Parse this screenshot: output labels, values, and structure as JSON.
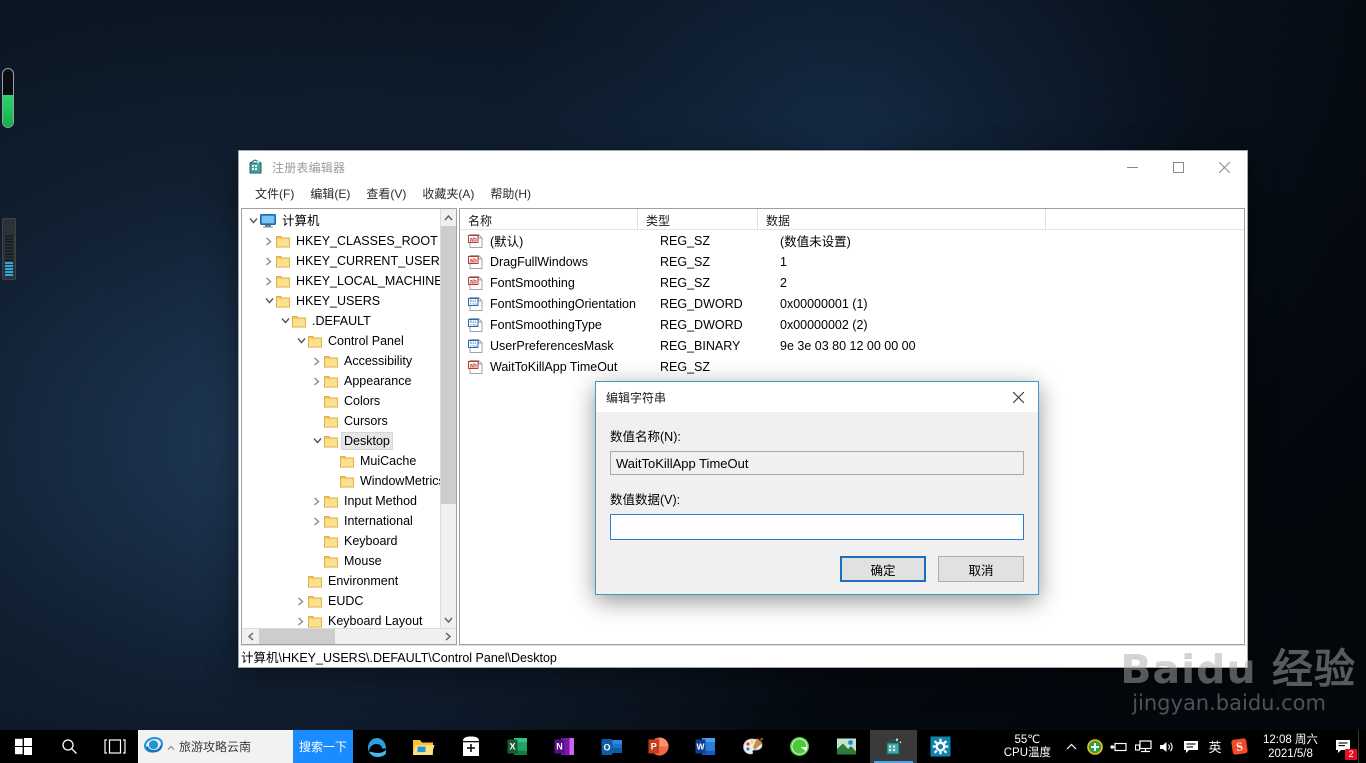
{
  "window": {
    "title": "注册表编辑器",
    "app_icon": "regedit-icon",
    "controls": {
      "minimize": "最小化",
      "maximize": "最大化",
      "close": "关闭"
    },
    "menu": [
      {
        "label": "文件(F)",
        "name": "menu-file"
      },
      {
        "label": "编辑(E)",
        "name": "menu-edit"
      },
      {
        "label": "查看(V)",
        "name": "menu-view"
      },
      {
        "label": "收藏夹(A)",
        "name": "menu-favorites"
      },
      {
        "label": "帮助(H)",
        "name": "menu-help"
      }
    ],
    "status_path": "计算机\\HKEY_USERS\\.DEFAULT\\Control Panel\\Desktop"
  },
  "tree": {
    "nodes": [
      {
        "label": "计算机",
        "indent": 0,
        "chevron": "down",
        "icon": "computer-icon",
        "selected": false
      },
      {
        "label": "HKEY_CLASSES_ROOT",
        "indent": 1,
        "chevron": "right",
        "icon": "folder-icon",
        "selected": false
      },
      {
        "label": "HKEY_CURRENT_USER",
        "indent": 1,
        "chevron": "right",
        "icon": "folder-icon",
        "selected": false
      },
      {
        "label": "HKEY_LOCAL_MACHINE",
        "indent": 1,
        "chevron": "right",
        "icon": "folder-icon",
        "selected": false
      },
      {
        "label": "HKEY_USERS",
        "indent": 1,
        "chevron": "down",
        "icon": "folder-icon",
        "selected": false
      },
      {
        "label": ".DEFAULT",
        "indent": 2,
        "chevron": "down",
        "icon": "folder-icon",
        "selected": false
      },
      {
        "label": "Control Panel",
        "indent": 3,
        "chevron": "down",
        "icon": "folder-icon",
        "selected": false
      },
      {
        "label": "Accessibility",
        "indent": 4,
        "chevron": "right",
        "icon": "folder-icon",
        "selected": false
      },
      {
        "label": "Appearance",
        "indent": 4,
        "chevron": "right",
        "icon": "folder-icon",
        "selected": false
      },
      {
        "label": "Colors",
        "indent": 4,
        "chevron": "none",
        "icon": "folder-icon",
        "selected": false
      },
      {
        "label": "Cursors",
        "indent": 4,
        "chevron": "none",
        "icon": "folder-icon",
        "selected": false
      },
      {
        "label": "Desktop",
        "indent": 4,
        "chevron": "down",
        "icon": "folder-icon",
        "selected": true
      },
      {
        "label": "MuiCache",
        "indent": 5,
        "chevron": "none",
        "icon": "folder-icon",
        "selected": false
      },
      {
        "label": "WindowMetrics",
        "indent": 5,
        "chevron": "none",
        "icon": "folder-icon",
        "selected": false
      },
      {
        "label": "Input Method",
        "indent": 4,
        "chevron": "right",
        "icon": "folder-icon",
        "selected": false
      },
      {
        "label": "International",
        "indent": 4,
        "chevron": "right",
        "icon": "folder-icon",
        "selected": false
      },
      {
        "label": "Keyboard",
        "indent": 4,
        "chevron": "none",
        "icon": "folder-icon",
        "selected": false
      },
      {
        "label": "Mouse",
        "indent": 4,
        "chevron": "none",
        "icon": "folder-icon",
        "selected": false
      },
      {
        "label": "Environment",
        "indent": 3,
        "chevron": "none",
        "icon": "folder-icon",
        "selected": false
      },
      {
        "label": "EUDC",
        "indent": 3,
        "chevron": "right",
        "icon": "folder-icon",
        "selected": false
      },
      {
        "label": "Keyboard Layout",
        "indent": 3,
        "chevron": "right",
        "icon": "folder-icon",
        "selected": false
      }
    ]
  },
  "list": {
    "columns": [
      {
        "label": "名称",
        "name": "col-name"
      },
      {
        "label": "类型",
        "name": "col-type"
      },
      {
        "label": "数据",
        "name": "col-data"
      }
    ],
    "rows": [
      {
        "name": "(默认)",
        "type": "REG_SZ",
        "data": "(数值未设置)",
        "icon": "reg-string-icon"
      },
      {
        "name": "DragFullWindows",
        "type": "REG_SZ",
        "data": "1",
        "icon": "reg-string-icon"
      },
      {
        "name": "FontSmoothing",
        "type": "REG_SZ",
        "data": "2",
        "icon": "reg-string-icon"
      },
      {
        "name": "FontSmoothingOrientation",
        "type": "REG_DWORD",
        "data": "0x00000001 (1)",
        "icon": "reg-binary-icon"
      },
      {
        "name": "FontSmoothingType",
        "type": "REG_DWORD",
        "data": "0x00000002 (2)",
        "icon": "reg-binary-icon"
      },
      {
        "name": "UserPreferencesMask",
        "type": "REG_BINARY",
        "data": "9e 3e 03 80 12 00 00 00",
        "icon": "reg-binary-icon"
      },
      {
        "name": "WaitToKillApp TimeOut",
        "type": "REG_SZ",
        "data": "",
        "icon": "reg-string-icon"
      }
    ]
  },
  "dialog": {
    "title": "编辑字符串",
    "close_label": "关闭",
    "name_label": "数值名称(N):",
    "name_value": "WaitToKillApp TimeOut",
    "data_label": "数值数据(V):",
    "data_value": "",
    "ok_label": "确定",
    "cancel_label": "取消"
  },
  "watermark": {
    "main": "Baidu 经验",
    "sub": "jingyan.baidu.com"
  },
  "taskbar": {
    "start_label": "开始",
    "search_label": "搜索",
    "taskview_label": "任务视图",
    "searchbox": {
      "value": "旅游攻略云南",
      "go_label": "搜索一下",
      "engine_icon": "ie-icon"
    },
    "apps": [
      {
        "name": "taskbar-app-edge",
        "icon": "edge-icon",
        "active": false
      },
      {
        "name": "taskbar-app-explorer",
        "icon": "folder-explorer-icon",
        "active": false
      },
      {
        "name": "taskbar-app-store",
        "icon": "store-icon",
        "active": false
      },
      {
        "name": "taskbar-app-excel",
        "icon": "excel-icon",
        "active": false
      },
      {
        "name": "taskbar-app-onenote",
        "icon": "onenote-icon",
        "active": false
      },
      {
        "name": "taskbar-app-outlook",
        "icon": "outlook-icon",
        "active": false
      },
      {
        "name": "taskbar-app-powerpoint",
        "icon": "powerpoint-icon",
        "active": false
      },
      {
        "name": "taskbar-app-word",
        "icon": "word-icon",
        "active": false
      },
      {
        "name": "taskbar-app-paint",
        "icon": "paint-icon",
        "active": false
      },
      {
        "name": "taskbar-app-360browser",
        "icon": "green-browser-icon",
        "active": false
      },
      {
        "name": "taskbar-app-picture",
        "icon": "picture-icon",
        "active": false
      },
      {
        "name": "taskbar-app-regedit",
        "icon": "regedit-icon",
        "active": true
      },
      {
        "name": "taskbar-app-settings",
        "icon": "settings-gear-icon",
        "active": false
      }
    ],
    "temp": {
      "value": "55℃",
      "label": "CPU温度"
    },
    "tray": [
      {
        "name": "tray-show-hidden-icons",
        "icon": "chevron-up-icon"
      },
      {
        "name": "tray-security",
        "icon": "shield-green-icon"
      },
      {
        "name": "tray-usb",
        "icon": "usb-eject-icon"
      },
      {
        "name": "tray-network",
        "icon": "network-icon"
      },
      {
        "name": "tray-volume",
        "icon": "speaker-icon"
      },
      {
        "name": "tray-input-panel",
        "icon": "ime-panel-icon"
      },
      {
        "name": "tray-ime-language",
        "icon": "ime-chinese-icon",
        "text": "英"
      },
      {
        "name": "tray-sogou-input",
        "icon": "sogou-icon"
      }
    ],
    "clock": {
      "time": "12:08 周六",
      "date": "2021/5/8"
    },
    "notifications": {
      "name": "action-center",
      "count": "2"
    }
  }
}
